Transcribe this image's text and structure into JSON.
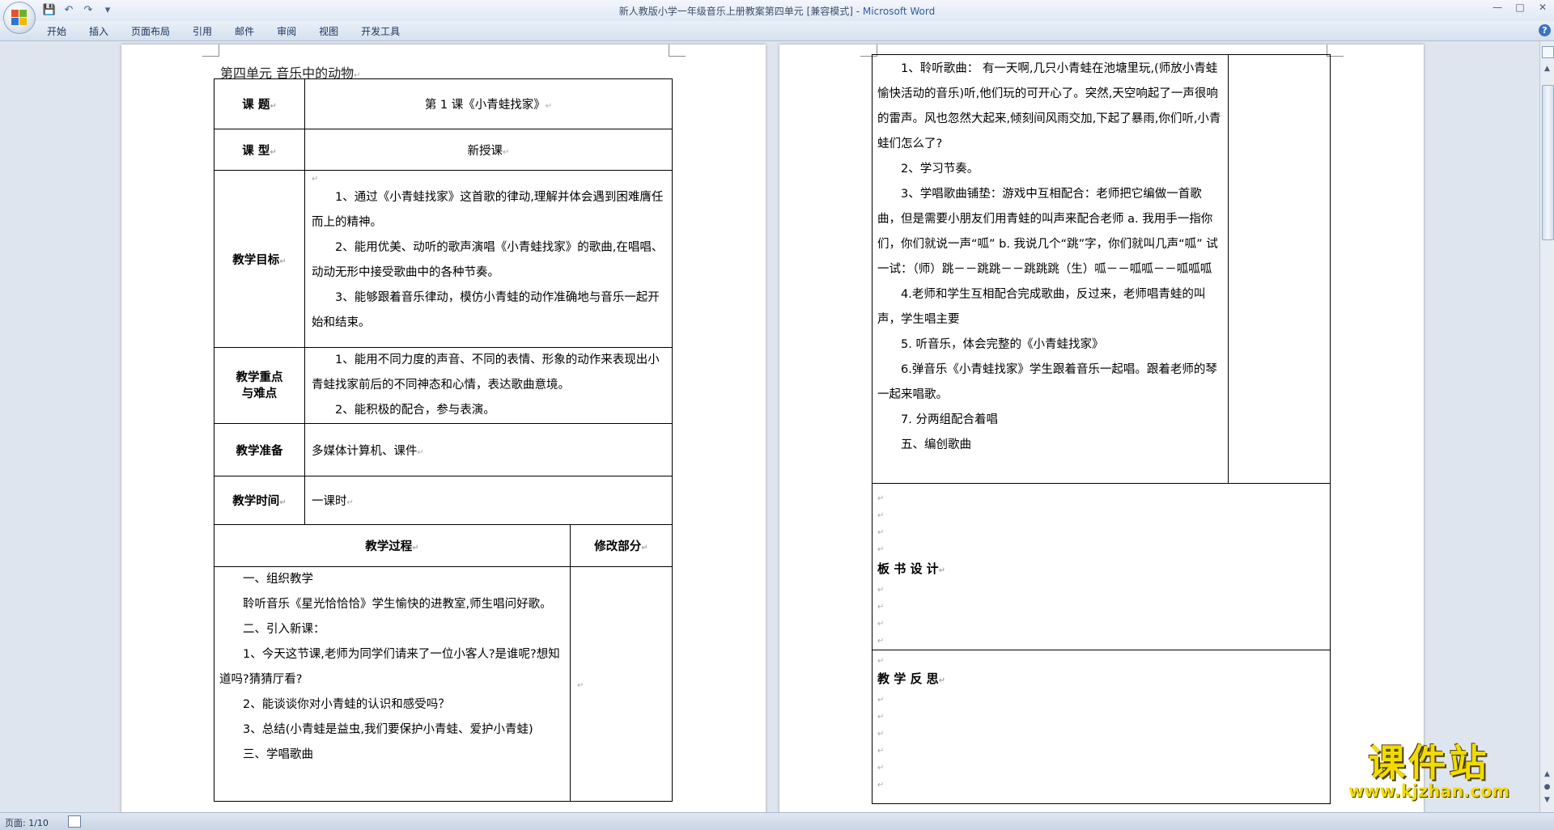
{
  "window": {
    "title_doc": "新人教版小学一年级音乐上册教案第四单元 [兼容模式] - ",
    "title_app": "Microsoft Word"
  },
  "ribbon": {
    "tabs": [
      "开始",
      "插入",
      "页面布局",
      "引用",
      "邮件",
      "审阅",
      "视图",
      "开发工具"
    ]
  },
  "page1": {
    "unit_title": "第四单元  音乐中的动物",
    "rows": {
      "topic_label": "课    题",
      "topic_value": "第 1 课《小青蛙找家》",
      "type_label": "课    型",
      "type_value": "新授课",
      "goal_label": "教学目标",
      "goals": [
        "1、通过《小青蛙找家》这首歌的律动,理解并体会遇到困难膺任而上的精神。",
        "2、能用优美、动听的歌声演唱《小青蛙找家》的歌曲,在唱唱、动动无形中接受歌曲中的各种节奏。",
        "3、能够跟着音乐律动，模仿小青蛙的动作准确地与音乐一起开始和结束。"
      ],
      "key_label": "教学重点与难点",
      "keys": [
        "1、能用不同力度的声音、不同的表情、形象的动作来表现出小青蛙找家前后的不同神态和心情，表达歌曲意境。",
        "2、能积极的配合，参与表演。"
      ],
      "prep_label": "教学准备",
      "prep_value": "多媒体计算机、课件",
      "time_label": "教学时间",
      "time_value": "一课时",
      "process_label": "教学过程",
      "modify_label": "修改部分",
      "process": [
        "一、组织教学",
        "聆听音乐《星光恰恰恰》学生愉快的进教室,师生唱问好歌。",
        "二、引入新课：",
        "1、今天这节课,老师为同学们请来了一位小客人?是谁呢?想知道吗?猜猜厅看?",
        "2、能谈谈你对小青蛙的认识和感受吗？",
        "3、总结(小青蛙是益虫,我们要保护小青蛙、爱护小青蛙)",
        "三、学唱歌曲"
      ]
    }
  },
  "page2": {
    "process": [
      "1、聆听歌曲： 有一天啊,几只小青蛙在池塘里玩,(师放小青蛙愉快活动的音乐)听,他们玩的可开心了。突然,天空响起了一声很响的雷声。风也忽然大起来,倾刻间风雨交加,下起了暴雨,你们听,小青蛙们怎么了?",
      "2、学习节奏。",
      "3、学唱歌曲铺垫：游戏中互相配合：老师把它编做一首歌曲，但是需要小朋友们用青蛙的叫声来配合老师   a. 我用手一指你们，你们就说一声“呱” b. 我说几个“跳”字，你们就叫几声“呱”    试一试：（师）跳－－跳跳－－跳跳跳（生）呱－－呱呱－－呱呱呱",
      "4.老师和学生互相配合完成歌曲，反过来，老师唱青蛙的叫声，学生唱主要",
      "5. 听音乐，体会完整的《小青蛙找家》",
      "6.弹音乐《小青蛙找家》学生跟着音乐一起唱。跟着老师的琴一起来唱歌。",
      "7. 分两组配合着唱",
      "五、编创歌曲"
    ],
    "board_label": "板 书 设 计",
    "reflect_label": "教 学 反 思"
  },
  "status": {
    "page_count": "页面: 1/10"
  },
  "watermark": {
    "cn": "课件站",
    "url": "www.kjzhan.com"
  },
  "colors": {
    "watermark": "#f2dc00",
    "app_blue": "#2e5d9f"
  }
}
